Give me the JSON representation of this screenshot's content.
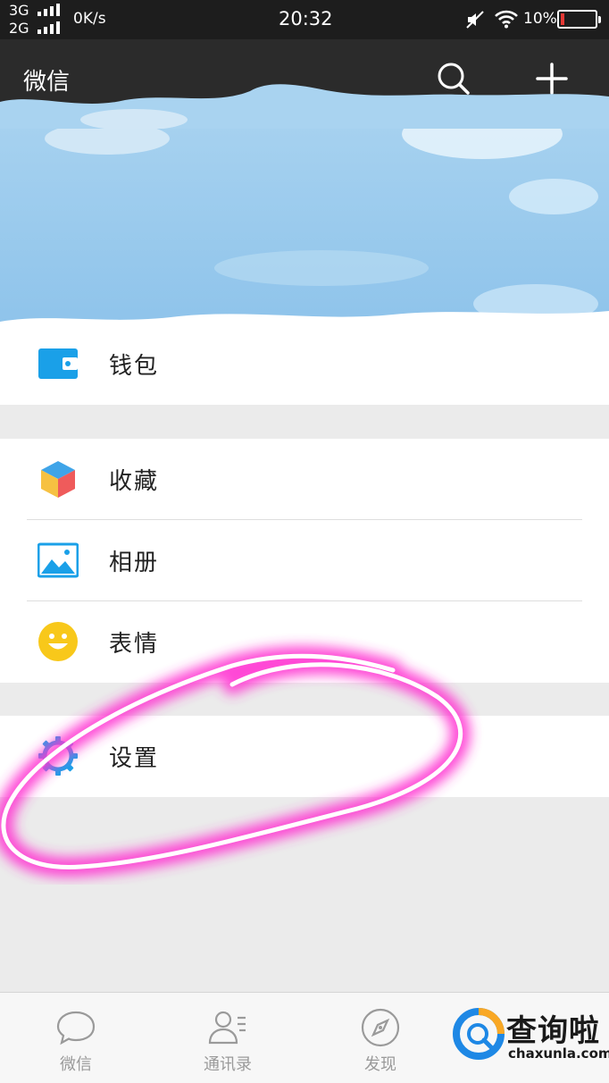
{
  "status_bar": {
    "network_top": "3G",
    "network_bottom": "2G",
    "speed": "0K/s",
    "time": "20:32",
    "battery_percent": "10%",
    "battery_level": 0.1,
    "battery_color": "#e53935"
  },
  "app_bar": {
    "title": "微信",
    "search_icon": "search-icon",
    "add_icon": "plus-icon"
  },
  "menu": {
    "wallet": {
      "label": "钱包",
      "icon": "wallet-icon",
      "color": "#1aa0e8"
    },
    "favorites": {
      "label": "收藏",
      "icon": "cube-icon"
    },
    "album": {
      "label": "相册",
      "icon": "picture-icon",
      "color": "#1aa0e8"
    },
    "stickers": {
      "label": "表情",
      "icon": "smiley-icon",
      "color": "#f8c81a"
    },
    "settings": {
      "label": "设置",
      "icon": "gear-icon",
      "color": "#1aa0e8"
    }
  },
  "annotation": {
    "color": "#ff3bd6",
    "shape": "hand-drawn loop around settings"
  },
  "tab_bar": {
    "tabs": [
      {
        "label": "微信",
        "icon": "chat-bubble-icon"
      },
      {
        "label": "通讯录",
        "icon": "contacts-icon"
      },
      {
        "label": "发现",
        "icon": "compass-icon"
      }
    ]
  },
  "watermark": {
    "title": "查询啦",
    "url": "chaxunla.com"
  }
}
